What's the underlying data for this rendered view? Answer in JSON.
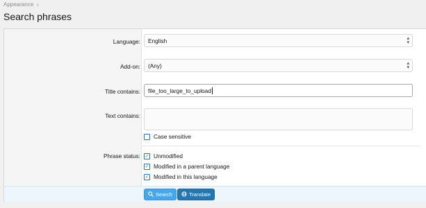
{
  "breadcrumb": {
    "items": [
      "Appearance"
    ],
    "separator": "›"
  },
  "page": {
    "title": "Search phrases"
  },
  "form": {
    "language": {
      "label": "Language:",
      "value": "English"
    },
    "addon": {
      "label": "Add-on:",
      "value": "(Any)"
    },
    "title_contains": {
      "label": "Title contains:",
      "value": "file_too_large_to_upload"
    },
    "text_contains": {
      "label": "Text contains:",
      "value": ""
    },
    "case_sensitive": {
      "label": "Case sensitive",
      "checked": false
    },
    "phrase_status": {
      "label": "Phrase status:",
      "options": [
        {
          "label": "Unmodified",
          "checked": true
        },
        {
          "label": "Modified in a parent language",
          "checked": true
        },
        {
          "label": "Modified in this language",
          "checked": true
        }
      ]
    }
  },
  "buttons": {
    "search": {
      "label": "Search",
      "icon": "search-icon"
    },
    "translate": {
      "label": "Translate",
      "icon": "globe-icon"
    }
  },
  "colors": {
    "accent": "#47a7eb",
    "accent_dark": "#2577b1",
    "footer_bg": "#edf6fd"
  }
}
